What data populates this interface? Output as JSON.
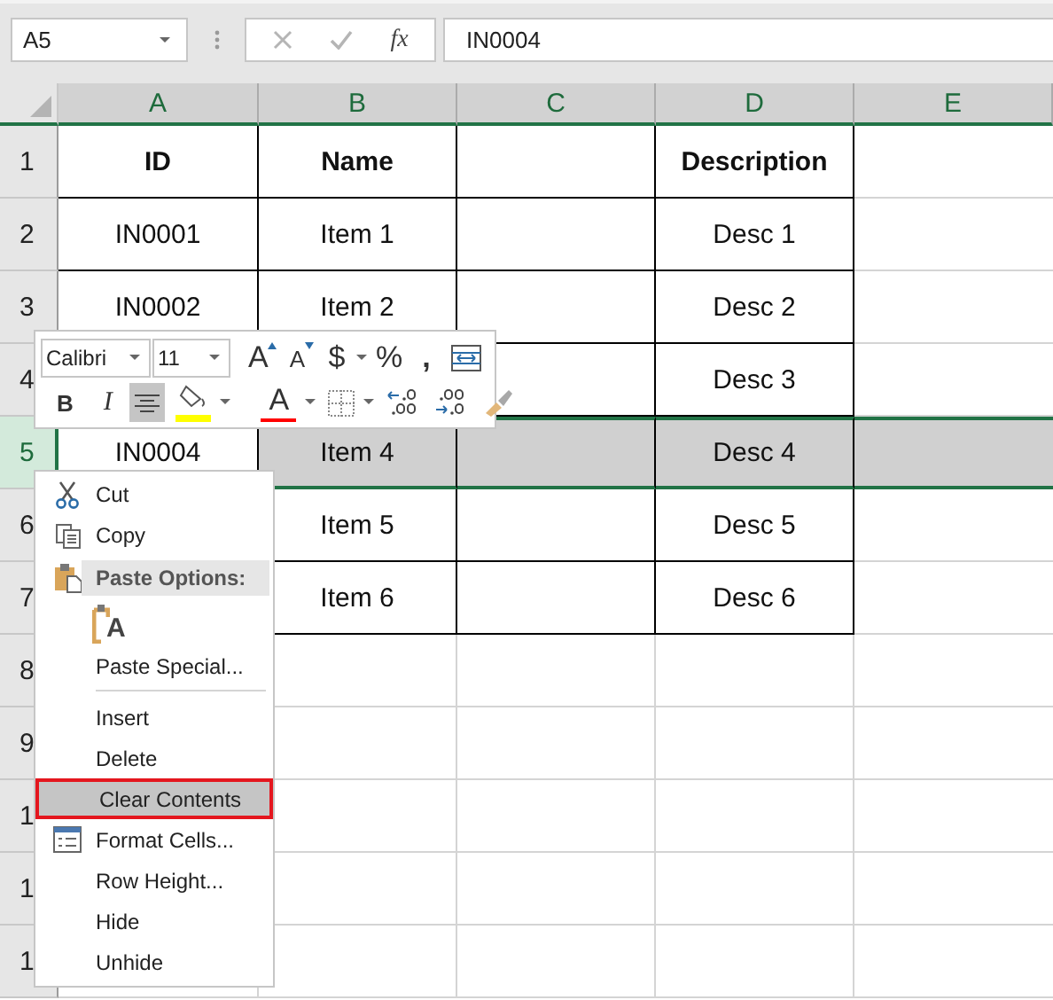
{
  "formula_bar": {
    "name_box": "A5",
    "function_label": "fx",
    "value": "IN0004"
  },
  "columns": [
    "A",
    "B",
    "C",
    "D",
    "E"
  ],
  "rows": [
    {
      "label": "1",
      "selected": false,
      "kind": "header",
      "cells": [
        {
          "text": "ID",
          "border": true
        },
        {
          "text": "Name",
          "border": true
        },
        {
          "border": true
        },
        {
          "text": "Description",
          "border": true
        },
        {
          "border": false
        }
      ]
    },
    {
      "label": "2",
      "selected": false,
      "kind": "data",
      "cells": [
        {
          "text": "IN0001",
          "border": true
        },
        {
          "text": "Item 1",
          "border": true
        },
        {
          "border": true
        },
        {
          "text": "Desc 1",
          "border": true
        },
        {
          "border": false
        }
      ]
    },
    {
      "label": "3",
      "selected": false,
      "kind": "data",
      "cells": [
        {
          "text": "IN0002",
          "border": true
        },
        {
          "text": "Item 2",
          "border": true
        },
        {
          "border": true
        },
        {
          "text": "Desc 2",
          "border": true
        },
        {
          "border": false
        }
      ]
    },
    {
      "label": "4",
      "selected": false,
      "kind": "data",
      "cells": [
        {},
        {},
        {
          "border": true
        },
        {
          "text": "Desc 3",
          "border": true
        },
        {
          "border": false
        }
      ]
    },
    {
      "label": "5",
      "selected": true,
      "kind": "data",
      "cells": [
        {
          "text": "IN0004",
          "border": true
        },
        {
          "text": "Item 4",
          "border": true
        },
        {
          "border": true
        },
        {
          "text": "Desc 4",
          "border": true
        },
        {
          "border": false
        }
      ]
    },
    {
      "label": "6",
      "selected": false,
      "kind": "data",
      "cells": [
        {},
        {
          "text": "Item 5",
          "border": true
        },
        {
          "border": true
        },
        {
          "text": "Desc 5",
          "border": true
        },
        {
          "border": false
        }
      ]
    },
    {
      "label": "7",
      "selected": false,
      "kind": "data",
      "cells": [
        {},
        {
          "text": "Item 6",
          "border": true
        },
        {
          "border": true
        },
        {
          "text": "Desc 6",
          "border": true
        },
        {
          "border": false
        }
      ]
    },
    {
      "label": "8",
      "selected": false,
      "kind": "data",
      "cells": [
        {},
        {
          "border": false
        },
        {
          "border": false
        },
        {
          "border": false
        },
        {
          "border": false
        }
      ]
    },
    {
      "label": "9",
      "selected": false,
      "kind": "data",
      "cells": [
        {},
        {
          "border": false
        },
        {
          "border": false
        },
        {
          "border": false
        },
        {
          "border": false
        }
      ]
    },
    {
      "label": "1",
      "selected": false,
      "kind": "data",
      "cells": [
        {},
        {
          "border": false
        },
        {
          "border": false
        },
        {
          "border": false
        },
        {
          "border": false
        }
      ]
    },
    {
      "label": "1",
      "selected": false,
      "kind": "data",
      "cells": [
        {},
        {
          "border": false
        },
        {
          "border": false
        },
        {
          "border": false
        },
        {
          "border": false
        }
      ]
    },
    {
      "label": "1",
      "selected": false,
      "kind": "data",
      "cells": [
        {
          "border": false
        },
        {
          "border": false
        },
        {
          "border": false
        },
        {
          "border": false
        },
        {
          "border": false
        }
      ]
    }
  ],
  "mini_toolbar": {
    "font": "Calibri",
    "size": "11",
    "row_1": [
      {
        "kind": "grow-font",
        "text": "A"
      },
      {
        "kind": "shrink-font",
        "text": "A"
      },
      {
        "kind": "currency",
        "text": "$",
        "dropdown": true
      },
      {
        "kind": "percent",
        "text": "%"
      },
      {
        "kind": "comma",
        "text": ","
      },
      {
        "kind": "wrap"
      }
    ],
    "row_2": [
      {
        "kind": "bold",
        "text": "B",
        "selected": false
      },
      {
        "kind": "italic",
        "text": "I",
        "selected": false
      },
      {
        "kind": "align-center",
        "selected": true
      },
      {
        "kind": "fill-color",
        "color": "#ffff00",
        "dropdown": true
      },
      {
        "kind": "font-color",
        "text": "A",
        "color": "#ff0000",
        "dropdown": true
      },
      {
        "kind": "borders",
        "dropdown": true
      },
      {
        "kind": "increase-decimal"
      },
      {
        "kind": "decrease-decimal"
      },
      {
        "kind": "format-painter"
      }
    ]
  },
  "context_menu": [
    {
      "kind": "command",
      "label": "Cut",
      "selected": false,
      "outlined": false
    },
    {
      "kind": "command",
      "label": "Copy",
      "selected": false,
      "outlined": false
    },
    {
      "kind": "header",
      "label": "Paste Options:"
    },
    {
      "kind": "paste-option",
      "text": "A"
    },
    {
      "kind": "command",
      "label": "Paste Special...",
      "selected": false,
      "outlined": false
    },
    {
      "kind": "separator"
    },
    {
      "kind": "command",
      "label": "Insert",
      "selected": false,
      "outlined": false
    },
    {
      "kind": "command",
      "label": "Delete",
      "selected": false,
      "outlined": false
    },
    {
      "kind": "command",
      "label": "Clear Contents",
      "selected": true,
      "outlined": true
    },
    {
      "kind": "command",
      "label": "Format Cells...",
      "selected": false,
      "outlined": false
    },
    {
      "kind": "command",
      "label": "Row Height...",
      "selected": false,
      "outlined": false
    },
    {
      "kind": "command",
      "label": "Hide",
      "selected": false,
      "outlined": false
    },
    {
      "kind": "command",
      "label": "Unhide",
      "selected": false,
      "outlined": false
    }
  ]
}
